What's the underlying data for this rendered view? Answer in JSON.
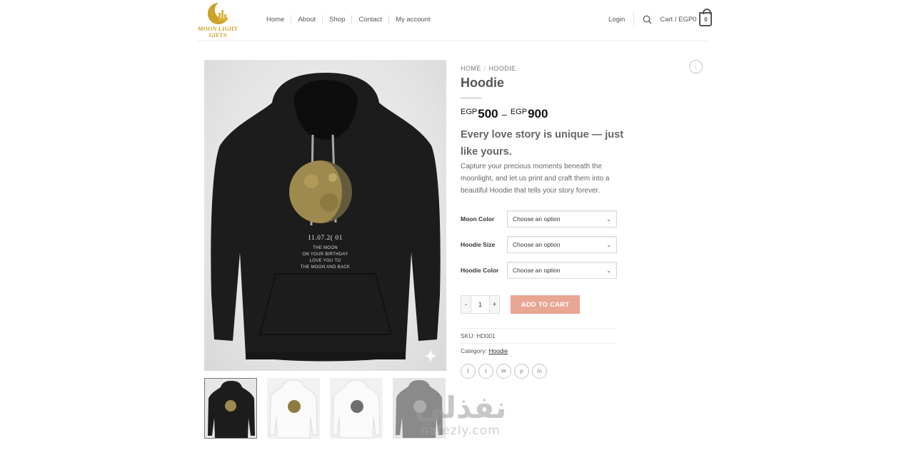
{
  "logo": {
    "line1": "MOON LIGHT",
    "line2": "GIFTS"
  },
  "nav": {
    "items": [
      "Home",
      "About",
      "Shop",
      "Contact",
      "My account"
    ]
  },
  "header_right": {
    "login": "Login",
    "cart_label": "Cart / EGP0",
    "cart_count": "0",
    "search_icon": "search-icon"
  },
  "breadcrumb": {
    "home": "HOME",
    "separator": "/",
    "current": "HOODIE"
  },
  "product": {
    "title": "Hoodie",
    "price": {
      "currency": "EGP",
      "min": "500",
      "dash": "–",
      "max": "900"
    },
    "tagline": "Every love story is unique — just like yours.",
    "description": "Capture your precious moments beneath the moonlight, and let us print and craft them into a beautiful Hoodie that tells your story forever.",
    "variations": [
      {
        "label": "Moon Color",
        "value": "Choose an option"
      },
      {
        "label": "Hoodie Size",
        "value": "Choose an option"
      },
      {
        "label": "Hoodie Color",
        "value": "Choose an option"
      }
    ],
    "quantity": {
      "minus": "-",
      "value": "1",
      "plus": "+"
    },
    "add_to_cart": "ADD TO CART",
    "sku": "SKU: HD001",
    "category_prefix": "Category: ",
    "category": "Hoodie",
    "image_text": {
      "date": "11.07.2( 01",
      "lines": [
        "THE MOON",
        "ON YOUR BIRTHDAY",
        "LOVE YOU TO",
        "THE MOON AND BACK"
      ]
    },
    "share": [
      "f",
      "t",
      "✉",
      "p",
      "in"
    ]
  },
  "watermark": {
    "arabic": "نفذلي",
    "latin": "nafezly.com"
  },
  "colors": {
    "accent": "#e8a693",
    "gold": "#c9a227",
    "hoodie": "#1c1c1c"
  }
}
